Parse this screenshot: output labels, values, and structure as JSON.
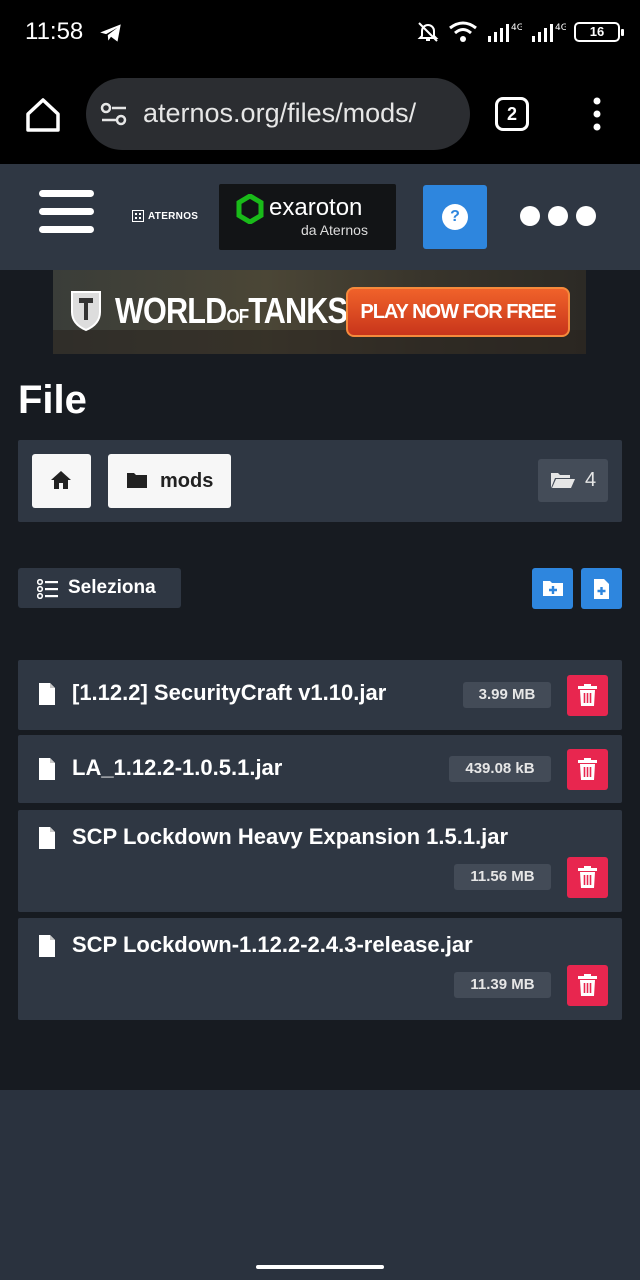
{
  "status_bar": {
    "time": "11:58",
    "network_1": "4G",
    "network_2": "4G",
    "battery": "16"
  },
  "browser": {
    "url": "aternos.org/files/mods/",
    "tab_count": "2"
  },
  "header": {
    "brand": "ATERNOS",
    "partner_name": "exaroton",
    "partner_sub": "da Aternos",
    "help_label": "?"
  },
  "ad": {
    "title": "WORLD OF TANKS",
    "title_main": "WORLD",
    "title_of": "OF",
    "title_tanks": "TANKS",
    "cta": "PLAY NOW FOR FREE"
  },
  "page": {
    "title": "File"
  },
  "breadcrumb": {
    "folder": "mods",
    "folder_count": "4"
  },
  "toolbar": {
    "select_label": "Seleziona"
  },
  "files": [
    {
      "name": "[1.12.2] SecurityCraft v1.10.jar",
      "size": "3.99 MB"
    },
    {
      "name": "LA_1.12.2-1.0.5.1.jar",
      "size": "439.08 kB"
    },
    {
      "name": "SCP Lockdown Heavy Expansion 1.5.1.jar",
      "size": "11.56 MB"
    },
    {
      "name": "SCP Lockdown-1.12.2-2.4.3-release.jar",
      "size": "11.39 MB"
    }
  ],
  "colors": {
    "accent_blue": "#2e86de",
    "danger_red": "#e8264f",
    "panel": "#2f3743",
    "page_bg": "#171b21"
  }
}
